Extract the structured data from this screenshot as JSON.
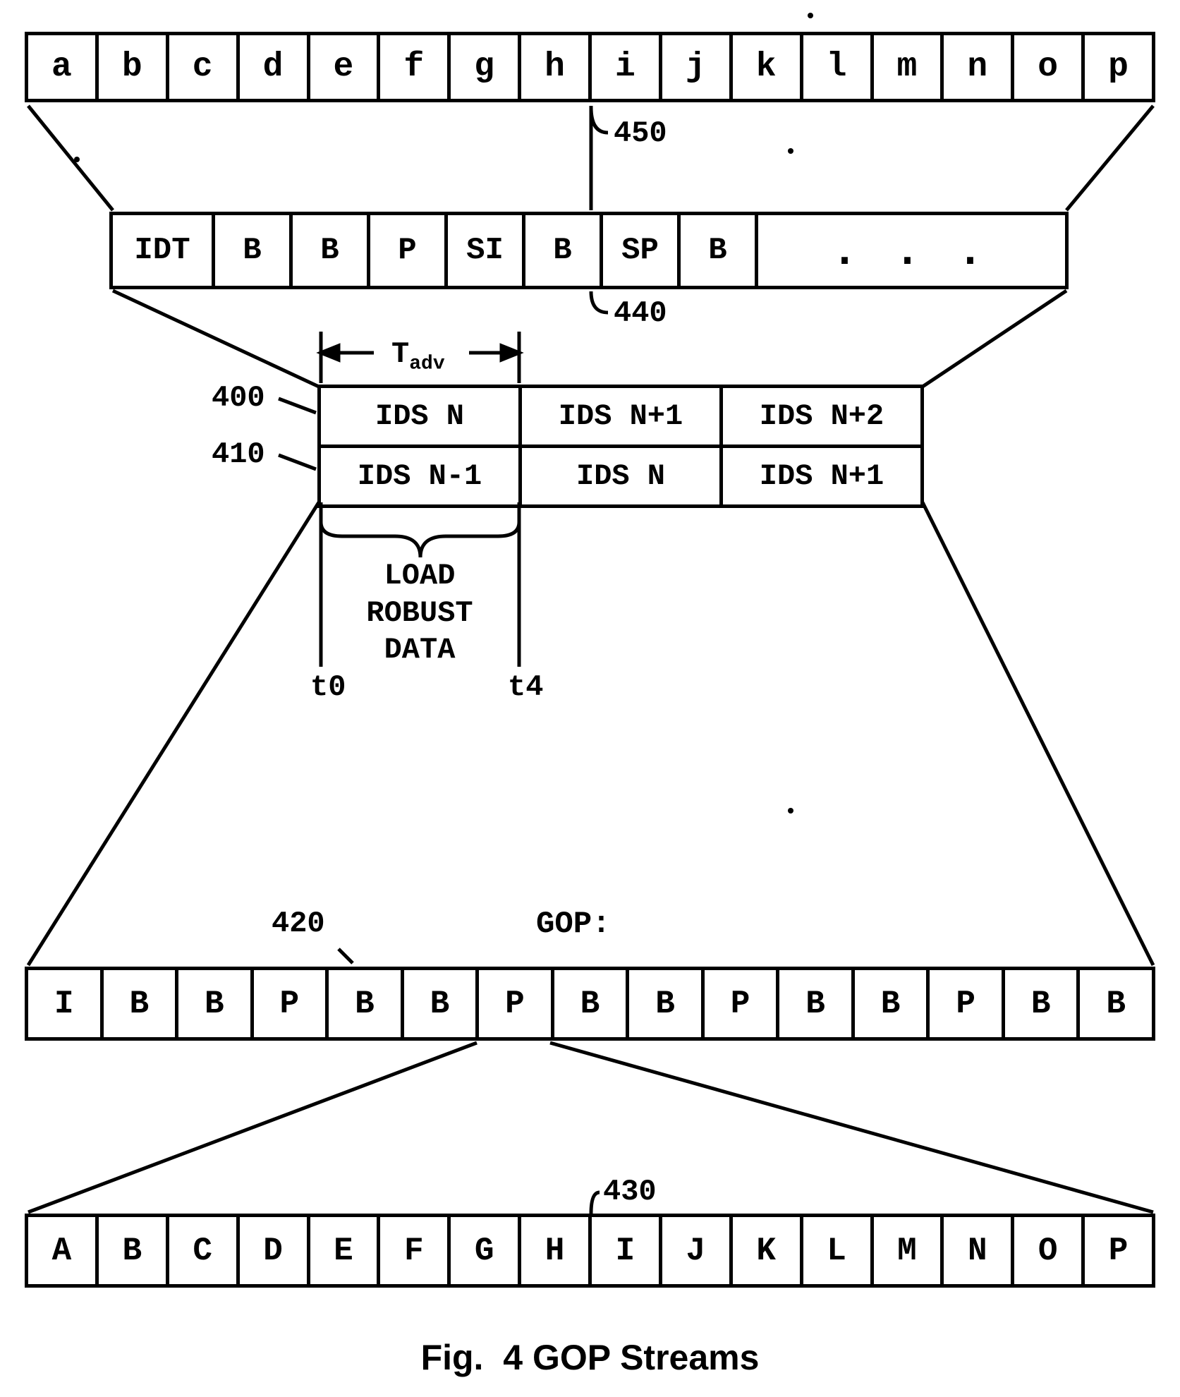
{
  "row450": {
    "cells": [
      "a",
      "b",
      "c",
      "d",
      "e",
      "f",
      "g",
      "h",
      "i",
      "j",
      "k",
      "l",
      "m",
      "n",
      "o",
      "p"
    ]
  },
  "row440": {
    "cells": [
      "IDT",
      "B",
      "B",
      "P",
      "SI",
      "B",
      "SP",
      "B"
    ],
    "rest": ". . ."
  },
  "streams": {
    "tadv_label_html": "T<sub>adv</sub>",
    "row400": [
      "IDS N",
      "IDS N+1",
      "IDS N+2"
    ],
    "row410": [
      "IDS N-1",
      "IDS N",
      "IDS N+1"
    ]
  },
  "refs": {
    "r400": "400",
    "r410": "410",
    "r420": "420",
    "r430": "430",
    "r440": "440",
    "r450": "450"
  },
  "time": {
    "t0": "t0",
    "t4": "t4"
  },
  "load_robust": "LOAD\nROBUST\nDATA",
  "gop_label": "GOP:",
  "row420": {
    "cells": [
      "I",
      "B",
      "B",
      "P",
      "B",
      "B",
      "P",
      "B",
      "B",
      "P",
      "B",
      "B",
      "P",
      "B",
      "B"
    ]
  },
  "row430": {
    "cells": [
      "A",
      "B",
      "C",
      "D",
      "E",
      "F",
      "G",
      "H",
      "I",
      "J",
      "K",
      "L",
      "M",
      "N",
      "O",
      "P"
    ]
  },
  "caption": {
    "fig": "Fig.",
    "num": "4",
    "title": "GOP Streams"
  }
}
